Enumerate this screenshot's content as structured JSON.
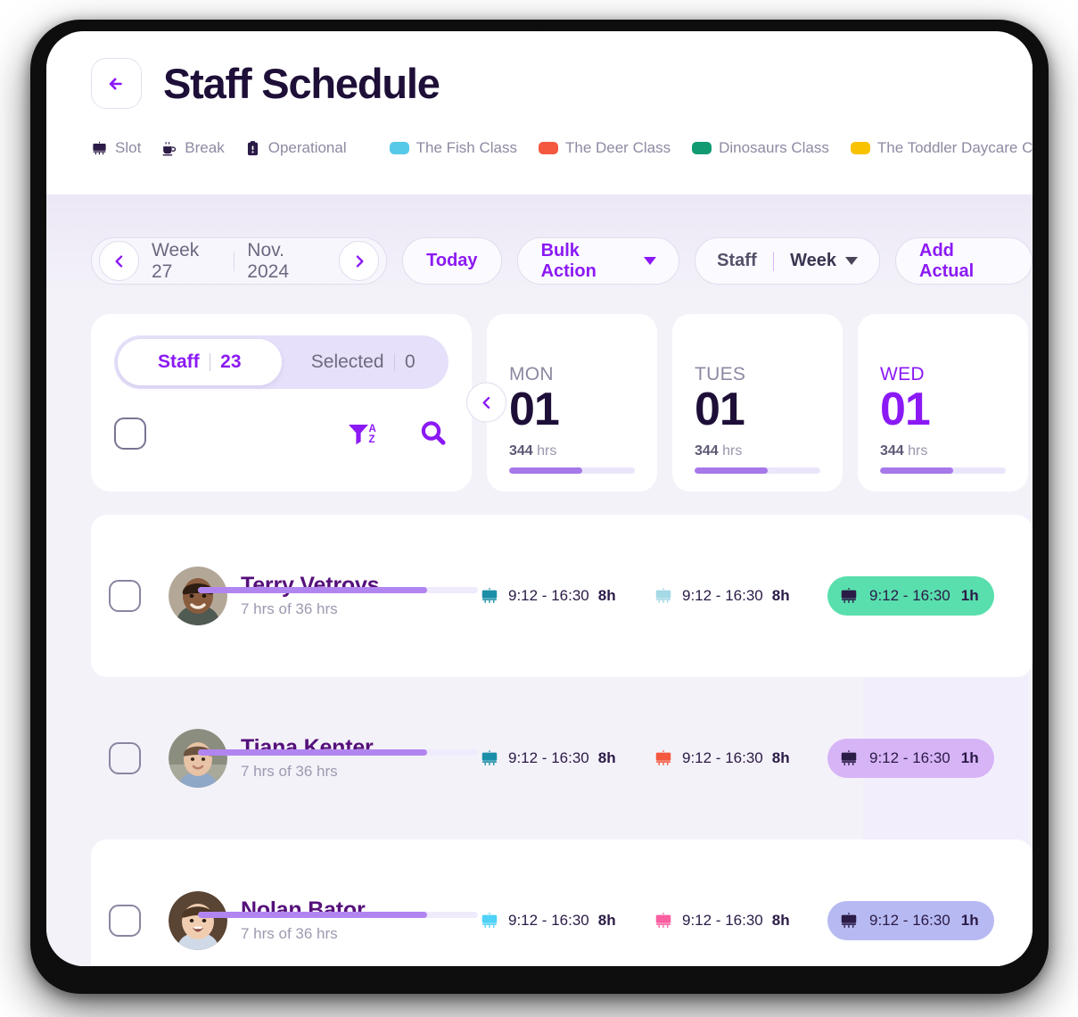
{
  "header": {
    "back_icon": "arrow-left-icon",
    "title": "Staff Schedule",
    "legend_types": [
      {
        "icon": "easel-icon",
        "label": "Slot"
      },
      {
        "icon": "coffee-cup-icon",
        "label": "Break"
      },
      {
        "icon": "clipboard-icon",
        "label": "Operational"
      }
    ],
    "legend_classes": [
      {
        "label": "The Fish Class",
        "color": "#56c8e8"
      },
      {
        "label": "The Deer Class",
        "color": "#f4583f"
      },
      {
        "label": "Dinosaurs Class",
        "color": "#129b72"
      },
      {
        "label": "The Toddler Daycare Class",
        "color": "#f8c200"
      }
    ]
  },
  "toolbar": {
    "prev_icon": "chevron-left-icon",
    "next_icon": "chevron-right-icon",
    "week": "Week 27",
    "month": "Nov. 2024",
    "today_label": "Today",
    "bulk_action_label": "Bulk Action",
    "view_scope": "Staff",
    "view_range": "Week",
    "add_actual_label": "Add Actual"
  },
  "staff_panel": {
    "tabs": [
      {
        "label": "Staff",
        "count": "23",
        "active": true
      },
      {
        "label": "Selected",
        "count": "0",
        "active": false
      }
    ],
    "select_all_checkbox": "unchecked",
    "filter_icon": "filter-az-icon",
    "search_icon": "search-icon"
  },
  "days": [
    {
      "name": "MON",
      "num": "01",
      "hours": "344",
      "hours_unit": "hrs",
      "progress": 58,
      "today": false
    },
    {
      "name": "TUES",
      "num": "01",
      "hours": "344",
      "hours_unit": "hrs",
      "progress": 58,
      "today": false
    },
    {
      "name": "WED",
      "num": "01",
      "hours": "344",
      "hours_unit": "hrs",
      "progress": 58,
      "today": true
    }
  ],
  "rows": [
    {
      "name": "Terry Vetrovs",
      "sub": "7 hrs of 36 hrs",
      "progress": 82,
      "row_style": "white",
      "shifts": [
        {
          "time": "9:12 - 16:30",
          "dur": "8h",
          "icon_color": "#1b8fa8",
          "chip_bg": "transparent",
          "filled": false
        },
        {
          "time": "9:12 - 16:30",
          "dur": "8h",
          "icon_color": "#a5d9e6",
          "chip_bg": "transparent",
          "filled": false
        },
        {
          "time": "9:12 - 16:30",
          "dur": "1h",
          "icon_color": "#2b1b47",
          "chip_bg": "#58dfad",
          "filled": true
        }
      ]
    },
    {
      "name": "Tiana Kenter",
      "sub": "7 hrs of 36 hrs",
      "progress": 82,
      "row_style": "tinted",
      "shifts": [
        {
          "time": "9:12 - 16:30",
          "dur": "8h",
          "icon_color": "#1b8fa8",
          "chip_bg": "transparent",
          "filled": false
        },
        {
          "time": "9:12 - 16:30",
          "dur": "8h",
          "icon_color": "#f4583f",
          "chip_bg": "transparent",
          "filled": false
        },
        {
          "time": "9:12 - 16:30",
          "dur": "1h",
          "icon_color": "#2b1b47",
          "chip_bg": "#d6b4f6",
          "filled": true
        }
      ]
    },
    {
      "name": "Nolan Bator",
      "sub": "7 hrs of 36 hrs",
      "progress": 82,
      "row_style": "white",
      "shifts": [
        {
          "time": "9:12 - 16:30",
          "dur": "8h",
          "icon_color": "#4fd2f7",
          "chip_bg": "transparent",
          "filled": false
        },
        {
          "time": "9:12 - 16:30",
          "dur": "8h",
          "icon_color": "#fa5fa0",
          "chip_bg": "transparent",
          "filled": false
        },
        {
          "time": "9:12 - 16:30",
          "dur": "1h",
          "icon_color": "#2b1b47",
          "chip_bg": "#b7b9f2",
          "filled": true
        }
      ]
    }
  ],
  "colors": {
    "accent": "#8b19f5",
    "title": "#1e0f38",
    "name": "#55107a",
    "muted": "#8e8aa3",
    "page_bg": "#f4f2f9"
  }
}
